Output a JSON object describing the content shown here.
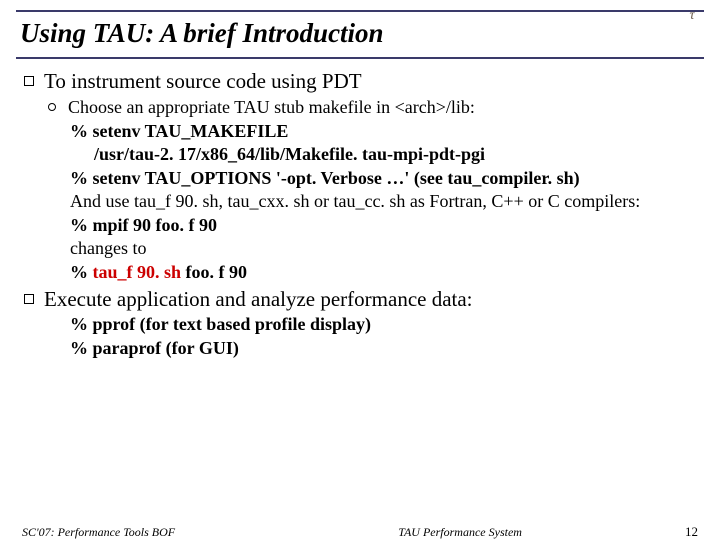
{
  "title": "Using TAU: A brief Introduction",
  "logo_text": "τ",
  "section1": {
    "heading": "To instrument source code using PDT",
    "sub1": "Choose an appropriate TAU stub makefile in <arch>/lib:",
    "line1a": "% setenv TAU_MAKEFILE",
    "line1b": "/usr/tau-2. 17/x86_64/lib/Makefile. tau-mpi-pdt-pgi",
    "line2": "% setenv TAU_OPTIONS '-opt. Verbose …' (see tau_compiler. sh)",
    "line3": "And use tau_f 90. sh, tau_cxx. sh or tau_cc. sh as Fortran, C++ or C compilers:",
    "line4": "% mpif 90 foo. f 90",
    "line5": "changes to",
    "line6a": "% ",
    "line6_red": "tau_f 90. sh",
    "line6b": " foo. f 90"
  },
  "section2": {
    "heading": "Execute application and analyze performance data:",
    "line1": "% pprof   (for text based profile display)",
    "line2": "% paraprof  (for GUI)"
  },
  "footer": {
    "left": "SC'07: Performance Tools BOF",
    "center": "TAU Performance System",
    "page": "12"
  }
}
